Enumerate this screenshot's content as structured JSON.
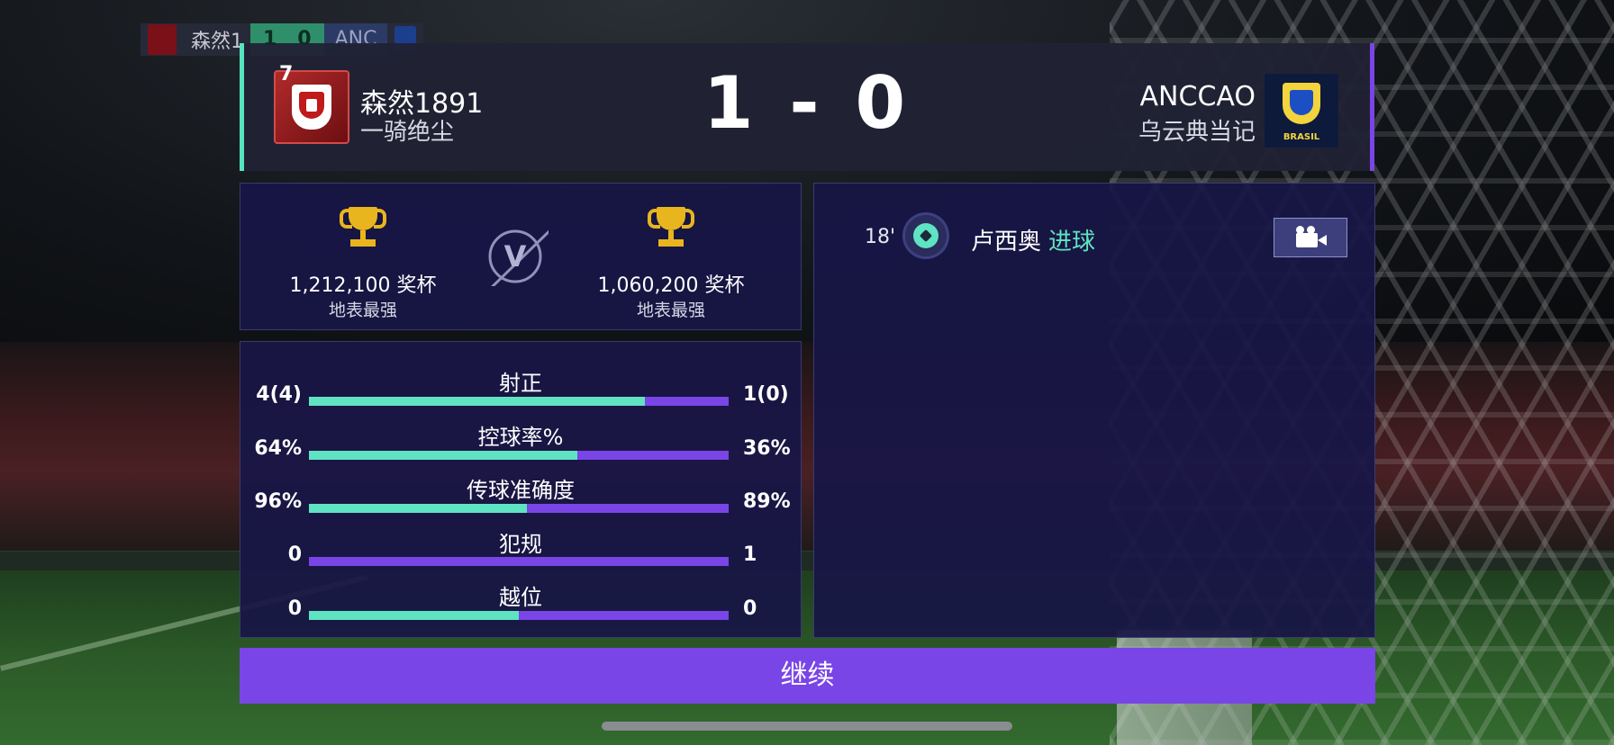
{
  "mini_scoreboard": {
    "home": "森然1",
    "score_home": "1",
    "score_away": "0",
    "away": "ANC"
  },
  "header": {
    "home_rank": "7",
    "home_name": "森然1891",
    "home_subtitle": "一骑绝尘",
    "score": "1 - 0",
    "away_name": "ANCCAO",
    "away_subtitle": "乌云典当记",
    "away_crest_text": "BRASIL"
  },
  "cups": {
    "home_count": "1,212,100 奖杯",
    "home_title": "地表最强",
    "versus": "V",
    "away_count": "1,060,200 奖杯",
    "away_title": "地表最强"
  },
  "stats": [
    {
      "label": "射正",
      "home": "4(4)",
      "away": "1(0)",
      "home_share": 0.8
    },
    {
      "label": "控球率%",
      "home": "64%",
      "away": "36%",
      "home_share": 0.64
    },
    {
      "label": "传球准确度",
      "home": "96%",
      "away": "89%",
      "home_share": 0.52
    },
    {
      "label": "犯规",
      "home": "0",
      "away": "1",
      "home_share": 0.0
    },
    {
      "label": "越位",
      "home": "0",
      "away": "0",
      "home_share": 0.5
    }
  ],
  "events": [
    {
      "minute": "18'",
      "player": "卢西奥",
      "type": "进球",
      "icon": "goal-ball-icon"
    }
  ],
  "continue_label": "继续",
  "colors": {
    "home_accent": "#5fe3c2",
    "away_accent": "#7a45e6",
    "trophy": "#e9b51e"
  }
}
